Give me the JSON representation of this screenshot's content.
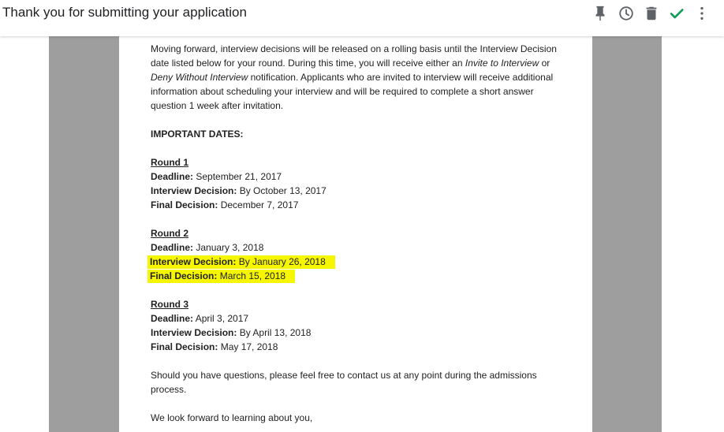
{
  "header": {
    "title": "Thank you for submitting your application",
    "actions": [
      {
        "icon": "pin-icon",
        "color": "#5f6368"
      },
      {
        "icon": "clock-icon",
        "color": "#5f6368"
      },
      {
        "icon": "trash-icon",
        "color": "#5f6368"
      },
      {
        "icon": "check-icon",
        "color": "#0f9d58"
      },
      {
        "icon": "more-vert-icon",
        "color": "#5f6368"
      }
    ]
  },
  "colors": {
    "gutter": "#9e9e9e",
    "highlight": "#f6f600",
    "check": "#0f9d58"
  },
  "document": {
    "intro": {
      "l1": "Moving forward, interview decisions will be released on a rolling basis until the Interview Decision",
      "l2_a": "date listed below for your round. During this time, you will receive either an ",
      "l2_i": "Invite to Interview",
      "l2_b": " or",
      "l3_i": "Deny Without Interview",
      "l3_b": " notification. Applicants who are invited to interview will receive additional",
      "l4": "information about scheduling your interview and will be required to complete a short answer",
      "l5": "question 1 week after invitation."
    },
    "important_heading": "IMPORTANT DATES:",
    "rounds": [
      {
        "name": "Round 1",
        "deadline_label": "Deadline:",
        "deadline": " September 21, 2017",
        "interview_label": "Interview Decision:",
        "interview": " By October 13, 2017",
        "final_label": "Final Decision:",
        "final": " December 7, 2017"
      },
      {
        "name": "Round 2",
        "deadline_label": "Deadline:",
        "deadline": " January 3, 2018",
        "interview_label": "Interview Decision:",
        "interview": " By January 26, 2018",
        "final_label": "Final Decision:",
        "final": " March 15, 2018"
      },
      {
        "name": "Round 3",
        "deadline_label": "Deadline:",
        "deadline": " April 3, 2017",
        "interview_label": "Interview Decision:",
        "interview": " By April 13, 2018",
        "final_label": "Final Decision:",
        "final": " May 17, 2018"
      }
    ],
    "questions": {
      "l1": "Should you have questions, please feel free to contact us at any point during the admissions",
      "l2": "process."
    },
    "closing": "We look forward to learning about you,"
  }
}
